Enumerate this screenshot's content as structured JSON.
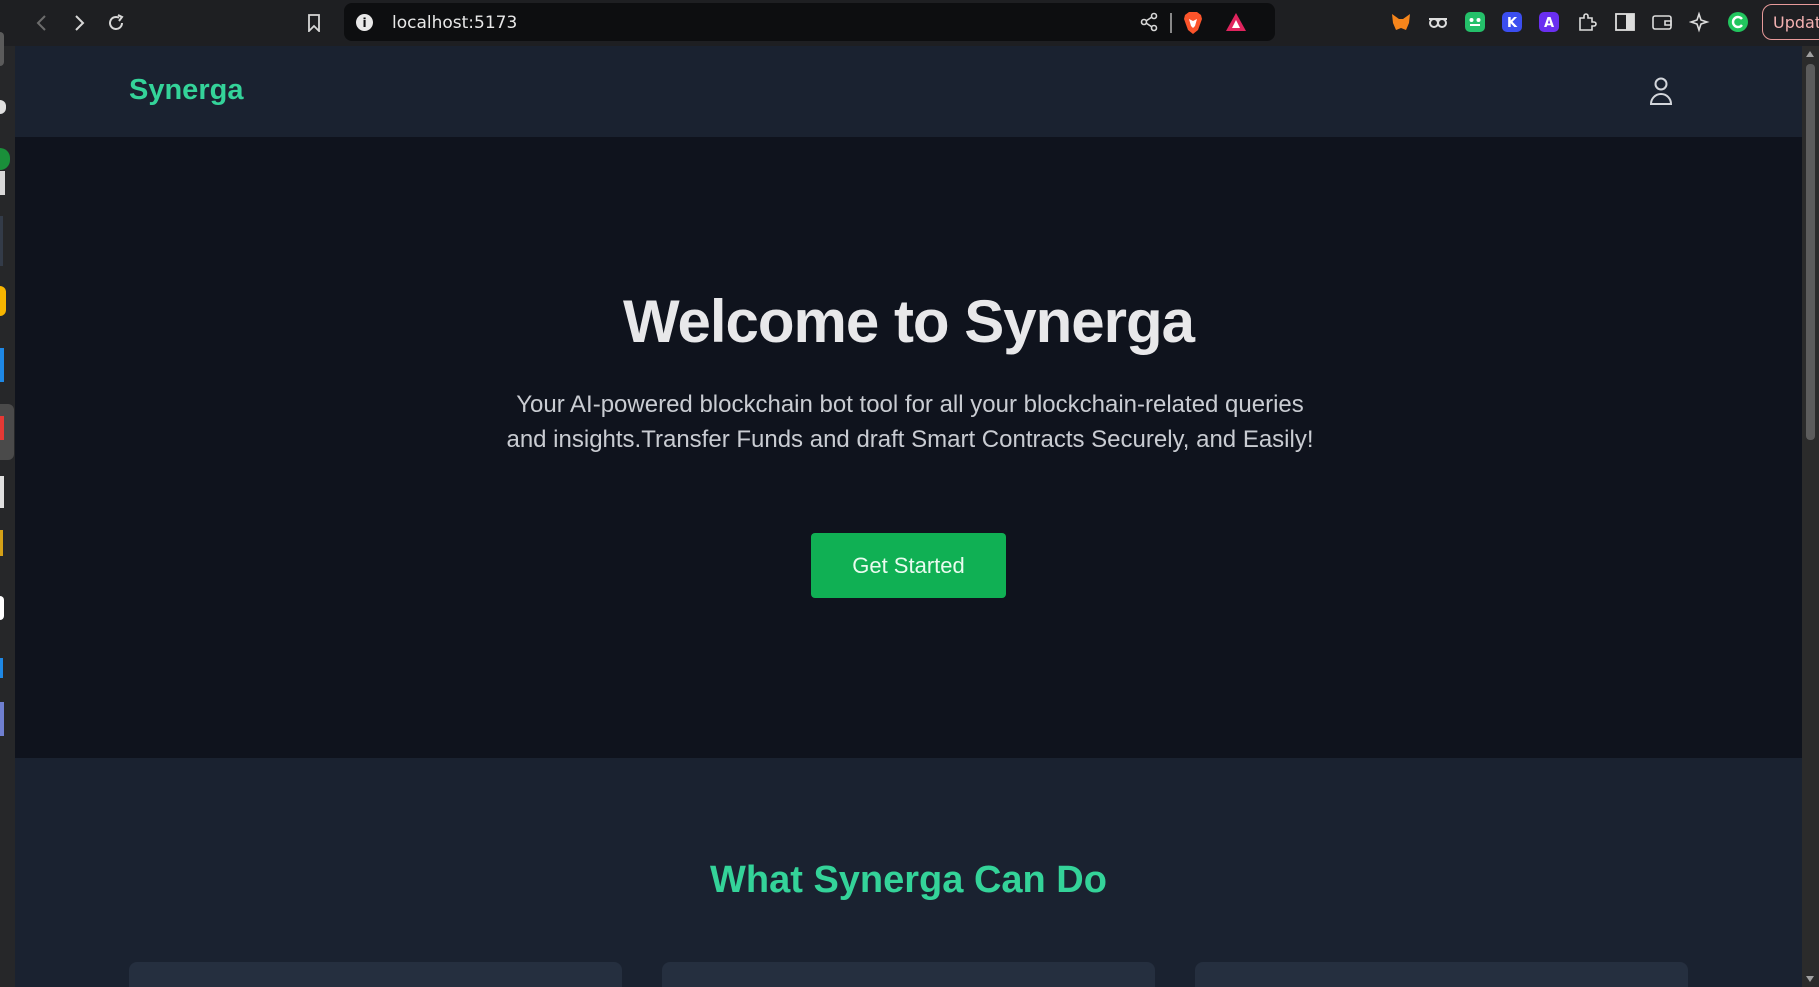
{
  "browser": {
    "url": "localhost:5173",
    "update_label": "Update"
  },
  "icons": {
    "back": "back-arrow-icon",
    "forward": "forward-arrow-icon",
    "reload": "reload-icon",
    "bookmark": "bookmark-icon",
    "info": "site-info-icon",
    "share": "share-icon",
    "brave_shields": "brave-shields-icon",
    "brave_rewards": "brave-rewards-icon",
    "user": "user-icon"
  },
  "colors": {
    "accent": "#34d399",
    "cta": "#10b054",
    "header_bg": "#1a2230",
    "hero_bg": "#0f131d"
  },
  "header": {
    "logo": "Synerga"
  },
  "hero": {
    "title": "Welcome to Synerga",
    "subtitle": "Your AI-powered blockchain bot tool for all your blockchain-related queries and insights.Transfer Funds and draft Smart Contracts Securely, and Easily!",
    "cta_label": "Get Started"
  },
  "features": {
    "title": "What Synerga Can Do"
  }
}
